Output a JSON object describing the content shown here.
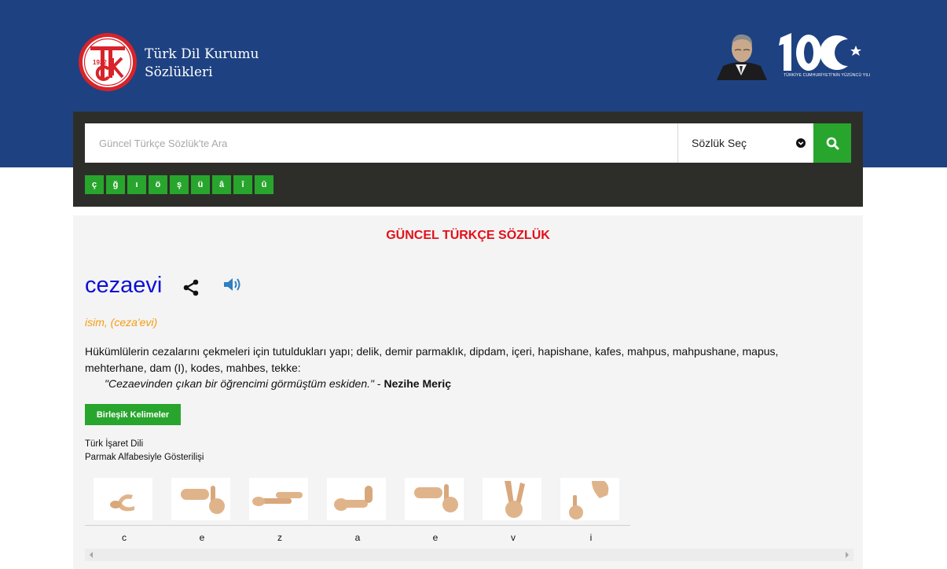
{
  "header": {
    "logo_year": "1932",
    "brand_line1": "Türk Dil Kurumu",
    "brand_line2": "Sözlükleri",
    "centennial_text": "TÜRKİYE CUMHURİYETİ'NİN YÜZÜNCÜ YILI"
  },
  "search": {
    "placeholder": "Güncel Türkçe Sözlük'te Ara",
    "value": "",
    "select_label": "Sözlük Seç",
    "keys": [
      "ç",
      "ğ",
      "ı",
      "ö",
      "ş",
      "ü",
      "â",
      "î",
      "û"
    ]
  },
  "entry": {
    "dictionary_name": "GÜNCEL TÜRKÇE SÖZLÜK",
    "word": "cezaevi",
    "word_type": "isim, (ceza'evi)",
    "meaning": "Hükümlülerin cezalarını çekmeleri için tutuldukları yapı; delik, demir parmaklık, dipdam, içeri, hapishane, kafes, mahpus, mahpushane, mapus, mehterhane, dam (I), kodes, mahbes, tekke:",
    "example_text": "\"Cezaevinden çıkan bir öğrencimi görmüştüm eskiden.\"",
    "example_sep": " - ",
    "example_author": "Nezihe Meriç",
    "compound_button": "Birleşik Kelimeler",
    "sign_title_line1": "Türk İşaret Dili",
    "sign_title_line2": "Parmak Alfabesiyle Gösterilişi",
    "sign_letters": [
      "c",
      "e",
      "z",
      "a",
      "e",
      "v",
      "i"
    ]
  },
  "colors": {
    "header_bg": "#1e4181",
    "panel_bg": "#2d2e2a",
    "accent_green": "#28a52d",
    "title_red": "#e3101a",
    "word_blue": "#0c10d6",
    "type_orange": "#f39c12"
  },
  "icons": [
    "tdk-logo",
    "ataturk-portrait",
    "centennial-logo",
    "chevron-down-icon",
    "search-icon",
    "share-icon",
    "speaker-icon"
  ]
}
